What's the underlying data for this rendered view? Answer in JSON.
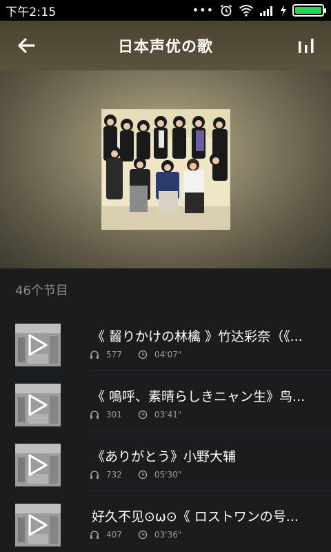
{
  "status_bar": {
    "time": "下午2:15",
    "dots": "•••",
    "battery_percent": 100,
    "battery_color": "#29d34a"
  },
  "header": {
    "title": "日本声优の歌",
    "back_icon": "arrow-left-icon",
    "right_icon": "equalizer-icon"
  },
  "section": {
    "program_count": "46个节目"
  },
  "programs": [
    {
      "title": "《 齧りかけの林檎 》竹达彩奈（《...",
      "plays": "577",
      "duration": "04'07\""
    },
    {
      "title": "《 嗚呼、素晴らしきニャン生》鸟...",
      "plays": "301",
      "duration": "03'41\""
    },
    {
      "title": "《ありがとう》小野大辅",
      "plays": "732",
      "duration": "05'30\""
    },
    {
      "title": "好久不见⊙ω⊙《 ロストワンの号...",
      "plays": "407",
      "duration": "03'36\""
    }
  ]
}
